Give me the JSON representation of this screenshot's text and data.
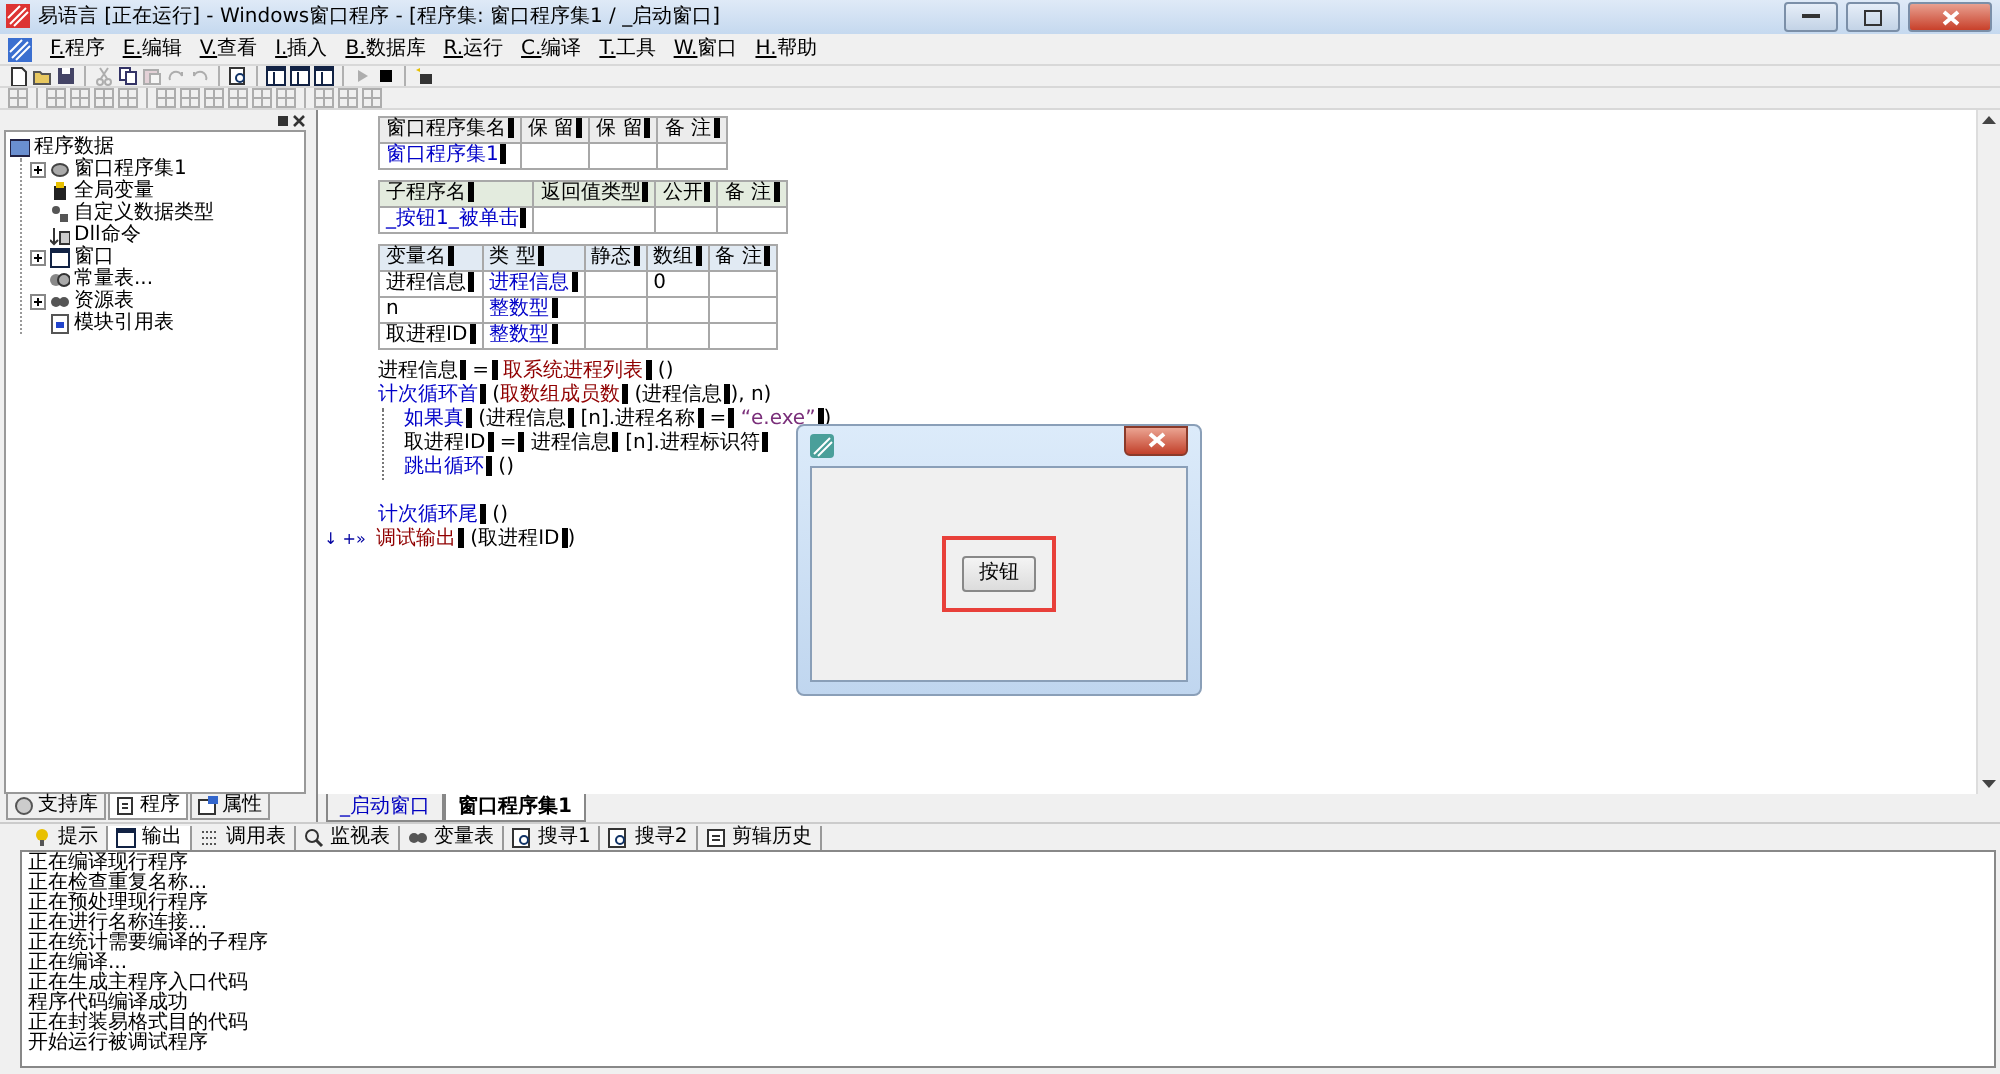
{
  "window": {
    "title": "易语言 [正在运行] - Windows窗口程序 - [程序集: 窗口程序集1 / _启动窗口]"
  },
  "menu": [
    {
      "label": "F.程序"
    },
    {
      "label": "E.编辑"
    },
    {
      "label": "V.查看"
    },
    {
      "label": "I.插入"
    },
    {
      "label": "B.数据库"
    },
    {
      "label": "R.运行"
    },
    {
      "label": "C.编译"
    },
    {
      "label": "T.工具"
    },
    {
      "label": "W.窗口"
    },
    {
      "label": "H.帮助"
    }
  ],
  "toolbar_1": [
    {
      "kind": "new",
      "disabled": false
    },
    {
      "kind": "open",
      "disabled": false
    },
    {
      "kind": "save",
      "disabled": false
    },
    {
      "kind": "sep"
    },
    {
      "kind": "cut",
      "disabled": true
    },
    {
      "kind": "copy",
      "disabled": false
    },
    {
      "kind": "paste",
      "disabled": true
    },
    {
      "kind": "redo",
      "disabled": true
    },
    {
      "kind": "undo",
      "disabled": true
    },
    {
      "kind": "sep"
    },
    {
      "kind": "find",
      "disabled": false
    },
    {
      "kind": "sep"
    },
    {
      "kind": "layout",
      "disabled": false
    },
    {
      "kind": "layout",
      "disabled": false
    },
    {
      "kind": "layout",
      "disabled": false
    },
    {
      "kind": "sep"
    },
    {
      "kind": "run",
      "disabled": true
    },
    {
      "kind": "stop",
      "disabled": false
    },
    {
      "kind": "sep"
    },
    {
      "kind": "search",
      "disabled": false
    }
  ],
  "toolbar_2": [
    {
      "kind": "grid",
      "disabled": true
    },
    {
      "kind": "sep"
    },
    {
      "kind": "grid",
      "disabled": true
    },
    {
      "kind": "grid",
      "disabled": true
    },
    {
      "kind": "grid",
      "disabled": true
    },
    {
      "kind": "grid",
      "disabled": true
    },
    {
      "kind": "sep"
    },
    {
      "kind": "grid",
      "disabled": true
    },
    {
      "kind": "grid",
      "disabled": true
    },
    {
      "kind": "grid",
      "disabled": true
    },
    {
      "kind": "grid",
      "disabled": true
    },
    {
      "kind": "grid",
      "disabled": true
    },
    {
      "kind": "grid",
      "disabled": true
    },
    {
      "kind": "sep"
    },
    {
      "kind": "grid",
      "disabled": true
    },
    {
      "kind": "grid",
      "disabled": true
    },
    {
      "kind": "grid",
      "disabled": true
    }
  ],
  "tree": {
    "label": "程序数据",
    "children": [
      {
        "label": "窗口程序集1",
        "kind": "module",
        "expandable": true,
        "expanded": false
      },
      {
        "label": "全局变量",
        "kind": "global"
      },
      {
        "label": "自定义数据类型",
        "kind": "type"
      },
      {
        "label": "Dll命令",
        "kind": "dll"
      },
      {
        "label": "窗口",
        "kind": "window",
        "expandable": true,
        "expanded": false
      },
      {
        "label": "常量表...",
        "kind": "const"
      },
      {
        "label": "资源表",
        "kind": "resource",
        "expandable": true,
        "expanded": false
      },
      {
        "label": "模块引用表",
        "kind": "ref"
      }
    ]
  },
  "left_tabs": [
    {
      "label": "支持库",
      "kind": "lib",
      "selected": false
    },
    {
      "label": "程序",
      "kind": "program",
      "selected": true
    },
    {
      "label": "属性",
      "kind": "props",
      "selected": false
    }
  ],
  "code": {
    "tables": [
      {
        "kind": "assembly",
        "columns": [
          "窗口程序集名",
          "保 留",
          "保 留",
          "备 注"
        ],
        "rows": [
          [
            {
              "text": "窗口程序集1",
              "kind": "ref",
              "bar": true
            },
            null,
            null,
            null
          ]
        ]
      },
      {
        "kind": "sub",
        "columns": [
          "子程序名",
          "返回值类型",
          "公开",
          "备 注"
        ],
        "rows": [
          [
            {
              "text": "_按钮1_被单击",
              "kind": "ref",
              "bar": true
            },
            null,
            null,
            null
          ]
        ]
      },
      {
        "kind": "vars",
        "columns": [
          "变量名",
          "类 型",
          "静态",
          "数组",
          "备 注"
        ],
        "rows": [
          [
            {
              "text": "进程信息",
              "kind": "plain",
              "bar": true
            },
            {
              "text": "进程信息",
              "kind": "ref",
              "bar": true
            },
            null,
            {
              "text": "0",
              "kind": "plain"
            },
            null
          ],
          [
            {
              "text": "n",
              "kind": "plain"
            },
            {
              "text": "整数型",
              "kind": "ref",
              "bar": true
            },
            null,
            null,
            null
          ],
          [
            {
              "text": "取进程ID",
              "kind": "plain",
              "bar": true
            },
            {
              "text": "整数型",
              "kind": "ref",
              "bar": true
            },
            null,
            null,
            null
          ]
        ]
      }
    ],
    "lines": [
      {
        "segments": [
          {
            "text": "进程信息",
            "kind": "plain",
            "bar": true
          },
          {
            "text": " =",
            "kind": "plain",
            "bar": true
          },
          {
            "text": " 取系统进程列表",
            "kind": "cmd",
            "bar": true
          },
          {
            "text": " ()",
            "kind": "plain"
          }
        ]
      },
      {
        "segments": [
          {
            "text": "计次循环首",
            "kind": "flow",
            "bar": true
          },
          {
            "text": " (",
            "kind": "plain"
          },
          {
            "text": "取数组成员数",
            "kind": "cmd",
            "bar": true
          },
          {
            "text": " (进程信息",
            "kind": "plain",
            "bar": true
          },
          {
            "text": "), n)",
            "kind": "plain"
          }
        ],
        "children": [
          {
            "segments": [
              {
                "text": "如果真",
                "kind": "flow",
                "bar": true
              },
              {
                "text": " (进程信息",
                "kind": "plain",
                "bar": true
              },
              {
                "text": " [n].进程名称",
                "kind": "plain",
                "bar": true
              },
              {
                "text": " =",
                "kind": "plain",
                "bar": true
              },
              {
                "text": " “e.exe”",
                "kind": "str",
                "bar": true
              },
              {
                "text": ")",
                "kind": "plain"
              }
            ]
          },
          {
            "segments": [
              {
                "text": "取进程ID",
                "kind": "plain",
                "bar": true
              },
              {
                "text": " =",
                "kind": "plain",
                "bar": true
              },
              {
                "text": " 进程信息",
                "kind": "plain",
                "bar": true
              },
              {
                "text": " [n].进程标识符",
                "kind": "plain",
                "bar": true
              }
            ]
          },
          {
            "segments": [
              {
                "text": "跳出循环",
                "kind": "flow",
                "bar": true
              },
              {
                "text": " ()",
                "kind": "plain"
              }
            ]
          }
        ]
      },
      {
        "segments": [
          {
            "text": "计次循环尾",
            "kind": "flow",
            "bar": true
          },
          {
            "text": " ()",
            "kind": "plain"
          }
        ]
      },
      {
        "marker": "↓ +»",
        "segments": [
          {
            "text": "调试输出",
            "kind": "cmd",
            "bar": true
          },
          {
            "text": " (取进程ID",
            "kind": "plain",
            "bar": true
          },
          {
            "text": ")",
            "kind": "plain"
          }
        ]
      }
    ]
  },
  "editor_tabs": [
    {
      "label": "_启动窗口",
      "selected": false
    },
    {
      "label": "窗口程序集1",
      "selected": true
    }
  ],
  "output_tabs": [
    {
      "label": "提示",
      "kind": "bulb",
      "selected": false
    },
    {
      "label": "输出",
      "kind": "window",
      "selected": true
    },
    {
      "label": "调用表",
      "kind": "list",
      "selected": false
    },
    {
      "label": "监视表",
      "kind": "magnifier",
      "selected": false
    },
    {
      "label": "变量表",
      "kind": "glasses",
      "selected": false
    },
    {
      "label": "搜寻1",
      "kind": "find",
      "selected": false
    },
    {
      "label": "搜寻2",
      "kind": "find",
      "selected": false
    },
    {
      "label": "剪辑历史",
      "kind": "clip",
      "selected": false
    }
  ],
  "output_lines": [
    "正在编译现行程序",
    "正在检查重复名称...",
    "正在预处理现行程序",
    "正在进行名称连接...",
    "正在统计需要编译的子程序",
    "正在编译...",
    "正在生成主程序入口代码",
    "程序代码编译成功",
    "正在封装易格式目的代码",
    "开始运行被调试程序"
  ],
  "dialog": {
    "button": {
      "label": "按钮",
      "highlighted": true
    }
  }
}
